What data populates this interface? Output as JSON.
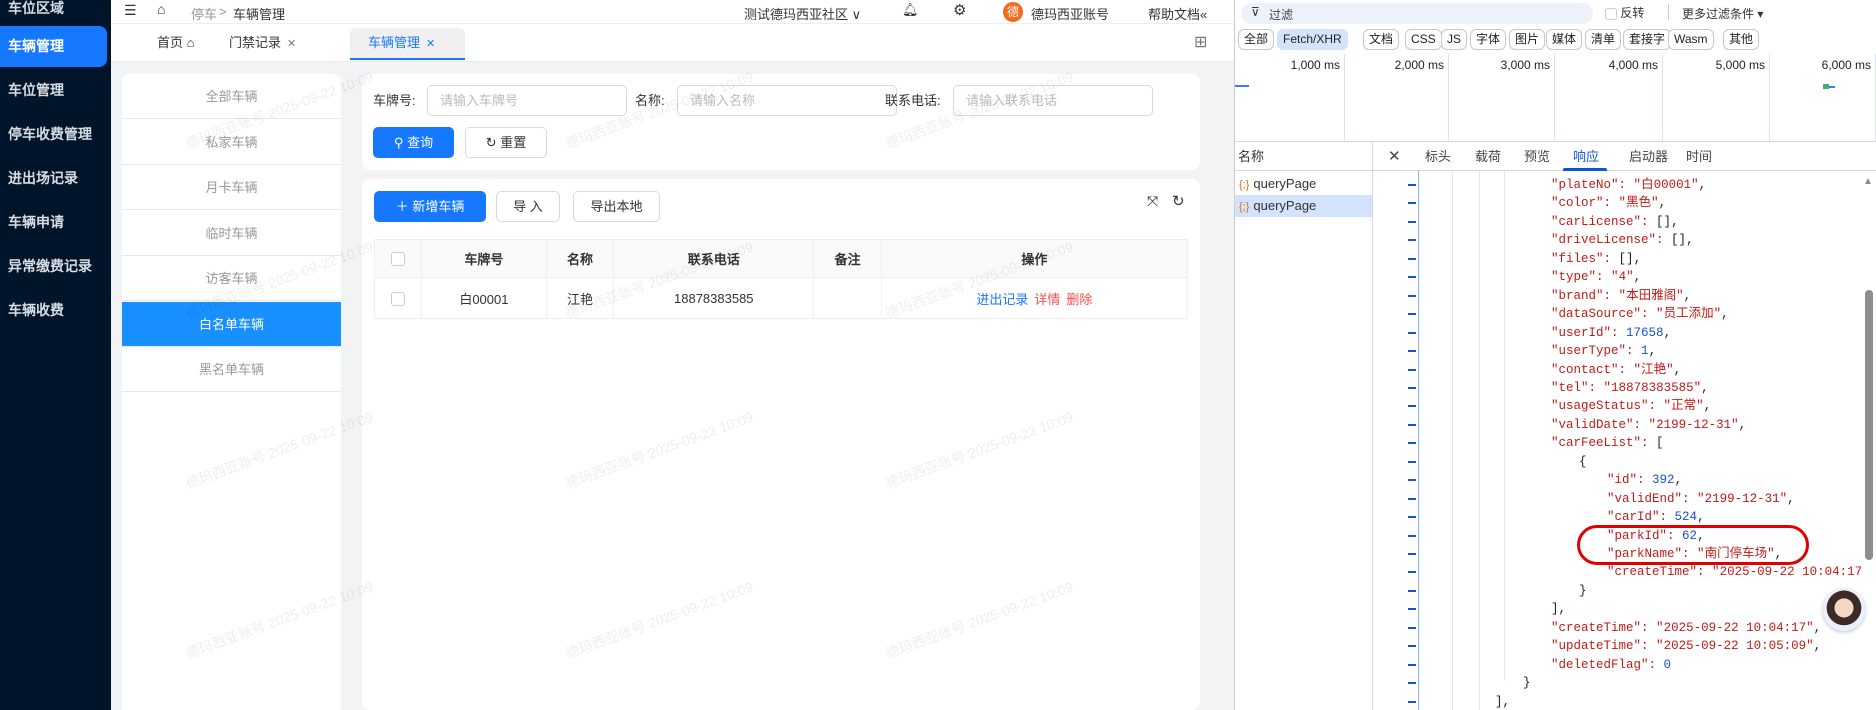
{
  "sidebar": {
    "items": [
      {
        "label": "车位区域",
        "active": false
      },
      {
        "label": "车辆管理",
        "active": true
      },
      {
        "label": "车位管理",
        "active": false
      },
      {
        "label": "停车收费管理",
        "active": false
      },
      {
        "label": "进出场记录",
        "active": false
      },
      {
        "label": "车辆申请",
        "active": false
      },
      {
        "label": "异常缴费记录",
        "active": false
      },
      {
        "label": "车辆收费",
        "active": false
      }
    ]
  },
  "topbar": {
    "breadcrumb": [
      "停车",
      "车辆管理"
    ],
    "separator": ">",
    "community": "测试德玛西亚社区",
    "avatar_char": "德",
    "account": "德玛西亚账号",
    "help": "帮助文档"
  },
  "tabs": [
    {
      "label": "首页"
    },
    {
      "label": "门禁记录"
    },
    {
      "label": "车辆管理"
    }
  ],
  "categories": [
    "全部车辆",
    "私家车辆",
    "月卡车辆",
    "临时车辆",
    "访客车辆",
    "白名单车辆",
    "黑名单车辆"
  ],
  "search": {
    "plate_label": "车牌号:",
    "plate_placeholder": "请输入车牌号",
    "name_label": "名称:",
    "name_placeholder": "请输入名称",
    "tel_label": "联系电话:",
    "tel_placeholder": "请输入联系电话",
    "query": "查询",
    "reset": "重置"
  },
  "toolbar": {
    "add": "新增车辆",
    "import": "导 入",
    "export": "导出本地"
  },
  "table": {
    "headers": [
      "车牌号",
      "名称",
      "联系电话",
      "备注",
      "操作"
    ],
    "rows": [
      {
        "plate": "白00001",
        "name": "江艳",
        "tel": "18878383585",
        "remark": "",
        "actions": [
          "进出记录",
          "详情",
          "删除"
        ]
      }
    ]
  },
  "watermark": "德玛西亚账号 2025-09-22 10:09",
  "devtools": {
    "filter_placeholder": "过滤",
    "invert": "反转",
    "more_filters": "更多过滤条件",
    "types": [
      "全部",
      "Fetch/XHR",
      "文档",
      "CSS",
      "JS",
      "字体",
      "图片",
      "媒体",
      "清单",
      "套接字",
      "Wasm",
      "其他"
    ],
    "active_type": "Fetch/XHR",
    "timeline": [
      "1,000 ms",
      "2,000 ms",
      "3,000 ms",
      "4,000 ms",
      "5,000 ms",
      "6,000 ms"
    ],
    "name_header": "名称",
    "requests": [
      "queryPage",
      "queryPage"
    ],
    "detail_tabs": [
      "标头",
      "载荷",
      "预览",
      "响应",
      "启动器",
      "时间"
    ],
    "active_detail_tab": "响应",
    "json_lines": [
      {
        "depth": 0,
        "k": "plateNo",
        "v": "白00001",
        "t": "s"
      },
      {
        "depth": 0,
        "k": "color",
        "v": "黑色",
        "t": "s"
      },
      {
        "depth": 0,
        "k": "carLicense",
        "v": "[]",
        "t": "r"
      },
      {
        "depth": 0,
        "k": "driveLicense",
        "v": "[]",
        "t": "r"
      },
      {
        "depth": 0,
        "k": "files",
        "v": "[]",
        "t": "r"
      },
      {
        "depth": 0,
        "k": "type",
        "v": "4",
        "t": "s"
      },
      {
        "depth": 0,
        "k": "brand",
        "v": "本田雅阁",
        "t": "s"
      },
      {
        "depth": 0,
        "k": "dataSource",
        "v": "员工添加",
        "t": "s"
      },
      {
        "depth": 0,
        "k": "userId",
        "v": "17658",
        "t": "n"
      },
      {
        "depth": 0,
        "k": "userType",
        "v": "1",
        "t": "n"
      },
      {
        "depth": 0,
        "k": "contact",
        "v": "江艳",
        "t": "s"
      },
      {
        "depth": 0,
        "k": "tel",
        "v": "18878383585",
        "t": "s"
      },
      {
        "depth": 0,
        "k": "usageStatus",
        "v": "正常",
        "t": "s"
      },
      {
        "depth": 0,
        "k": "validDate",
        "v": "2199-12-31",
        "t": "s"
      },
      {
        "depth": 0,
        "k": "carFeeList",
        "v": "[",
        "t": "o"
      },
      {
        "depth": 1,
        "raw": "{"
      },
      {
        "depth": 2,
        "k": "id",
        "v": "392",
        "t": "n"
      },
      {
        "depth": 2,
        "k": "validEnd",
        "v": "2199-12-31",
        "t": "s"
      },
      {
        "depth": 2,
        "k": "carId",
        "v": "524",
        "t": "n"
      },
      {
        "depth": 2,
        "k": "parkId",
        "v": "62",
        "t": "n"
      },
      {
        "depth": 2,
        "k": "parkName",
        "v": "南门停车场",
        "t": "s"
      },
      {
        "depth": 2,
        "k": "createTime",
        "v": "2025-09-22 10:04:17",
        "t": "s",
        "last": true
      },
      {
        "depth": 1,
        "raw": "}"
      },
      {
        "depth": 0,
        "raw": "],"
      },
      {
        "depth": 0,
        "k": "createTime",
        "v": "2025-09-22 10:04:17",
        "t": "s"
      },
      {
        "depth": 0,
        "k": "updateTime",
        "v": "2025-09-22 10:05:09",
        "t": "s"
      },
      {
        "depth": 0,
        "k": "deletedFlag",
        "v": "0",
        "t": "n",
        "last": true
      },
      {
        "depth": -1,
        "raw": "}"
      },
      {
        "depth": -2,
        "raw": "],"
      }
    ]
  },
  "colors": {
    "primary": "#1677ff",
    "sidebar": "#001529",
    "danger": "#ff4d4f",
    "highlight": "#e00000"
  }
}
